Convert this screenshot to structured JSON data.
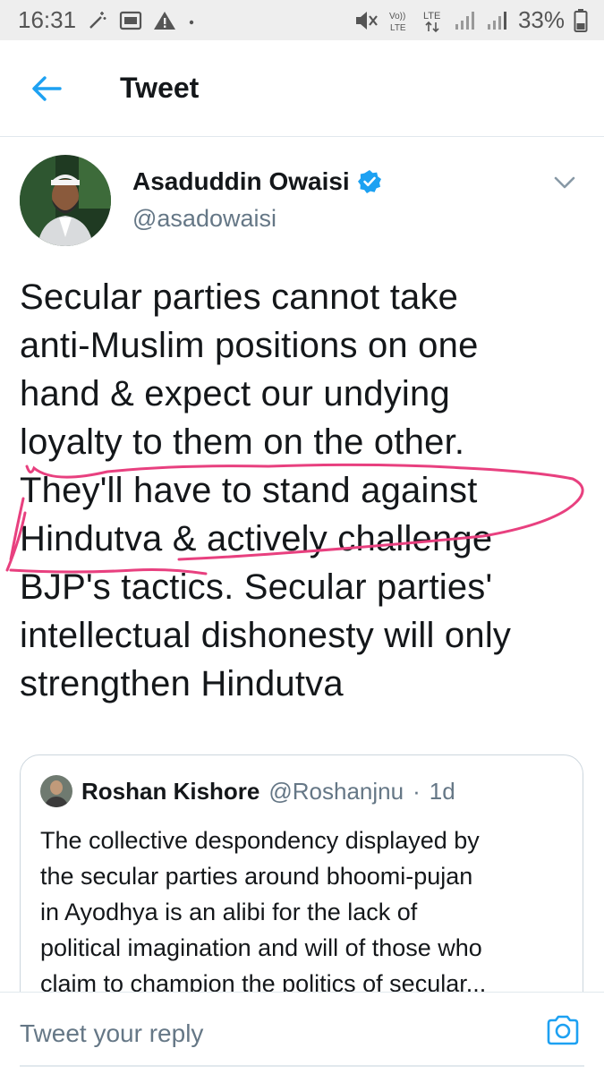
{
  "status_bar": {
    "time": "16:31",
    "battery": "33%",
    "net_badge": "Vo)) LTE",
    "lte_badge": "LTE"
  },
  "header": {
    "title": "Tweet"
  },
  "tweet": {
    "author_name": "Asaduddin Owaisi",
    "author_handle": "@asadowaisi",
    "text_lines": [
      "Secular parties cannot take",
      "anti-Muslim positions on one",
      "hand & expect our undying",
      "loyalty to them on the other.",
      "They'll have to stand against",
      "Hindutva & actively challenge",
      "BJP's tactics. Secular parties'",
      "intellectual dishonesty will only",
      "strengthen Hindutva"
    ],
    "verified": true
  },
  "quoted_tweet": {
    "author_name": "Roshan Kishore",
    "author_handle": "@Roshanjnu",
    "separator": "·",
    "time": "1d",
    "text_lines": [
      "The collective despondency displayed by",
      "the secular parties around bhoomi-pujan",
      "in Ayodhya is an alibi for the lack of",
      "political imagination and will of those who",
      "claim to champion the politics of secular..."
    ]
  },
  "reply": {
    "placeholder": "Tweet your reply"
  },
  "icons": {
    "back": "arrow-left-icon",
    "verified": "verified-badge-icon",
    "caret": "chevron-down-icon",
    "camera": "camera-icon"
  },
  "colors": {
    "twitter_blue": "#1da1f2",
    "scribble_pink": "#e8407f",
    "secondary_text": "#657786"
  }
}
